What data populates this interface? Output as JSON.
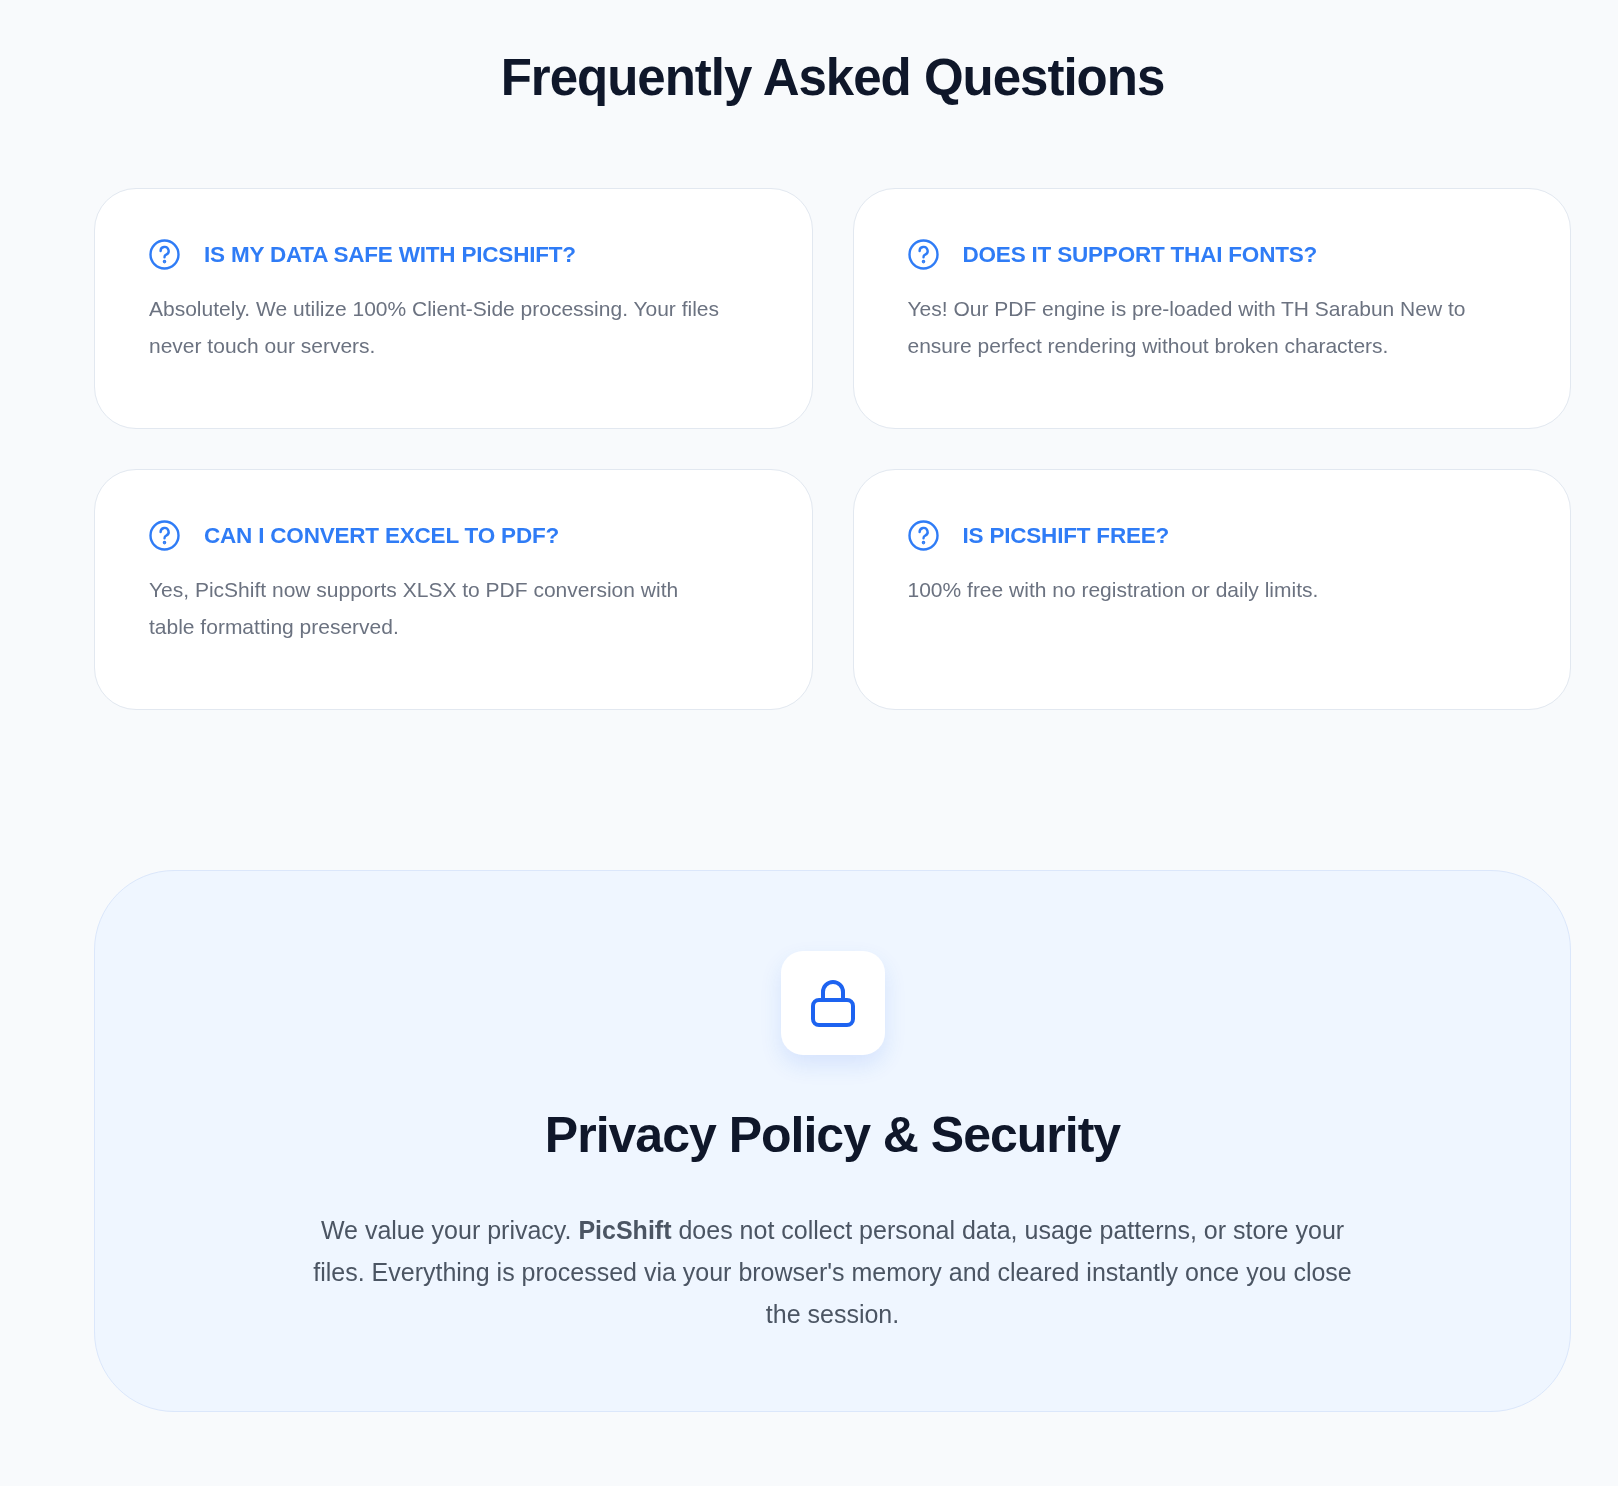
{
  "faq": {
    "title": "Frequently Asked Questions",
    "items": [
      {
        "question": "IS MY DATA SAFE WITH PICSHIFT?",
        "answer": "Absolutely. We utilize 100% Client-Side processing. Your files never touch our servers."
      },
      {
        "question": "DOES IT SUPPORT THAI FONTS?",
        "answer": "Yes! Our PDF engine is pre-loaded with TH Sarabun New to ensure perfect rendering without broken characters."
      },
      {
        "question": "CAN I CONVERT EXCEL TO PDF?",
        "answer": "Yes, PicShift now supports XLSX to PDF conversion with table formatting preserved."
      },
      {
        "question": "IS PICSHIFT FREE?",
        "answer": "100% free with no registration or daily limits."
      }
    ]
  },
  "privacy": {
    "title": "Privacy Policy & Security",
    "text": "We value your privacy. **PicShift** does not collect personal data, usage patterns, or store your files. Everything is processed via your browser's memory and cleared instantly once you close the session."
  }
}
